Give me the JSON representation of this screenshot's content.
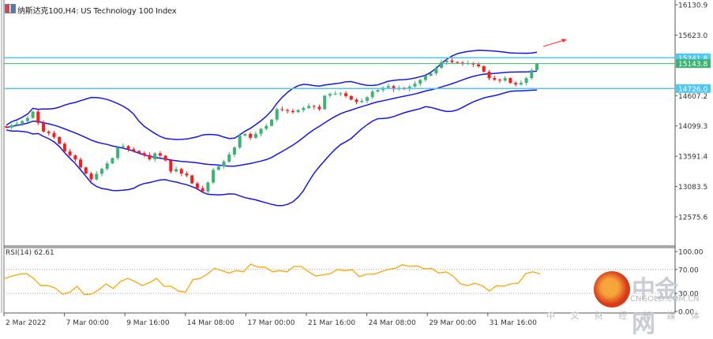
{
  "window": {
    "title": "纳斯达克100,H4: US Technology 100 Index",
    "icon": "chart-window-icon"
  },
  "colors": {
    "up": "#3cb371",
    "down": "#ff1a1a",
    "bands": "#1515ee",
    "level": "#4fc8f5",
    "current": "#3cb371",
    "rsi": "#ffa500",
    "arrow": "#ff3333"
  },
  "chart_data": [
    {
      "type": "candlestick",
      "title": "",
      "y_ticks": [
        "16130.9",
        "15623.0",
        "14607.2",
        "14099.3",
        "13591.4",
        "13083.5",
        "12575.6"
      ],
      "ylim": [
        12575.6,
        16130.9
      ],
      "x_ticks": [
        "2 Mar 2022",
        "7 Mar 00:00",
        "9 Mar 16:00",
        "14 Mar 08:00",
        "17 Mar 00:00",
        "21 Mar 16:00",
        "24 Mar 08:00",
        "29 Mar 00:00",
        "31 Mar 16:00"
      ],
      "closes": [
        14072,
        14110,
        14139,
        14180,
        14232,
        14339,
        14150,
        14005,
        13980,
        13912,
        13800,
        13671,
        13604,
        13537,
        13404,
        13300,
        13203,
        13297,
        13380,
        13470,
        13560,
        13738,
        13760,
        13711,
        13680,
        13644,
        13610,
        13540,
        13640,
        13600,
        13520,
        13337,
        13377,
        13300,
        13270,
        13136,
        13056,
        13002,
        13150,
        13363,
        13420,
        13500,
        13620,
        13738,
        13938,
        13965,
        13900,
        13965,
        14050,
        14100,
        14206,
        14380,
        14366,
        14350,
        14330,
        14366,
        14400,
        14433,
        14420,
        14380,
        14607,
        14634,
        14640,
        14647,
        14600,
        14540,
        14500,
        14520,
        14580,
        14674,
        14700,
        14741,
        14767,
        14714,
        14740,
        14714,
        14760,
        14807,
        14870,
        14941,
        14981,
        15075,
        15168,
        15195,
        15170,
        15160,
        15142,
        15150,
        15130,
        15100,
        15008,
        14901,
        14874,
        14860,
        14901,
        14820,
        14794,
        14821,
        14900,
        15035,
        15143.8
      ],
      "indicator": "Bollinger Bands",
      "levels": [
        {
          "value": "15241.8",
          "kind": "horizontal-line"
        },
        {
          "value": "15143.8",
          "kind": "current-price"
        },
        {
          "value": "14726.0",
          "kind": "horizontal-line"
        }
      ],
      "annotation": "red-up-arrow"
    },
    {
      "type": "line",
      "label": "RSI(14) 62.61",
      "y_ticks": [
        "100.00",
        "70.00",
        "30.00",
        "0.00"
      ],
      "ylim": [
        0,
        100
      ],
      "dotted_levels": [
        70,
        30
      ],
      "values": [
        55,
        59,
        62,
        63,
        55,
        43,
        43,
        39,
        29,
        32,
        42,
        28,
        29,
        36,
        46,
        38,
        50,
        55,
        50,
        43,
        48,
        55,
        42,
        42,
        34,
        32,
        53,
        55,
        62,
        72,
        68,
        64,
        68,
        66,
        79,
        74,
        74,
        66,
        68,
        66,
        75,
        75,
        66,
        59,
        61,
        63,
        70,
        68,
        70,
        58,
        62,
        62,
        66,
        70,
        72,
        78,
        75,
        76,
        71,
        72,
        64,
        66,
        59,
        46,
        43,
        47,
        43,
        34,
        43,
        42,
        46,
        47,
        63,
        66,
        62.61
      ]
    }
  ],
  "watermark": {
    "brand_cn": "中金网",
    "brand_en": "CNGOLD.COM.CN",
    "tagline": "中 文 财 经 新 媒 体"
  }
}
